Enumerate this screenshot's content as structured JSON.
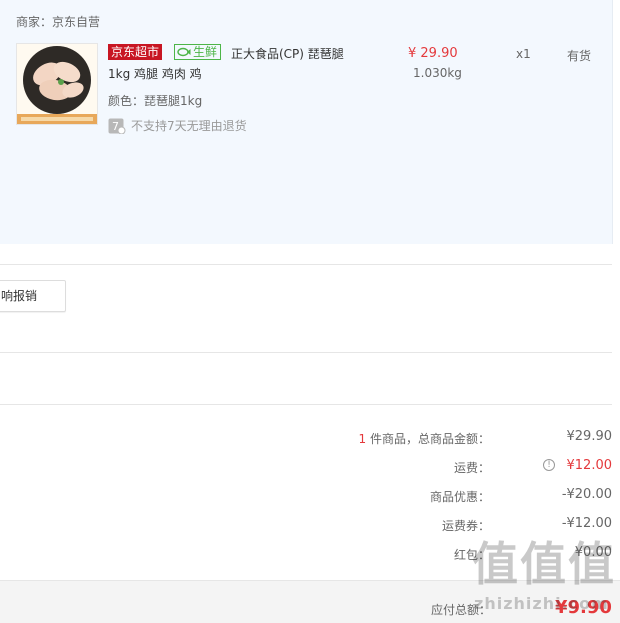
{
  "colors": {
    "price_red": "#e4393c",
    "market_red": "#c81623",
    "fresh_green": "#4db548",
    "panel_bg": "#f3f8fe"
  },
  "shop": {
    "label": "商家：京东自营"
  },
  "product": {
    "image_icon": "roast-chicken-legs-photo",
    "badge_market": "京东超市",
    "badge_fresh": "生鲜",
    "fresh_icon": "fish-icon",
    "title_line1": "正大食品(CP) 琵琶腿",
    "title_line2": "1kg 鸡腿 鸡肉 鸡",
    "color_label": "颜色：琵琶腿1kg",
    "no_return_icon": "seven-day-no-return-icon",
    "no_return_text": "不支持7天无理由退货",
    "price": "¥ 29.90",
    "weight": "1.030kg",
    "qty": "x1",
    "stock": "有货"
  },
  "invoice": {
    "button_label": "响报销"
  },
  "summary": {
    "count": "1",
    "items_label": "件商品，总商品金额：",
    "items_value": "¥29.90",
    "shipping_label": "运费：",
    "shipping_value": "¥12.00",
    "discount_label": "商品优惠：",
    "discount_value": "-¥20.00",
    "shipping_coupon_label": "运费券：",
    "shipping_coupon_value": "-¥12.00",
    "redpacket_label": "红包：",
    "redpacket_value": "¥0.00"
  },
  "footer": {
    "total_label": "应付总额：",
    "total_value": "¥9.90"
  },
  "watermark": {
    "glyphs": "值值值",
    "text": "zhizhizhi.com"
  }
}
